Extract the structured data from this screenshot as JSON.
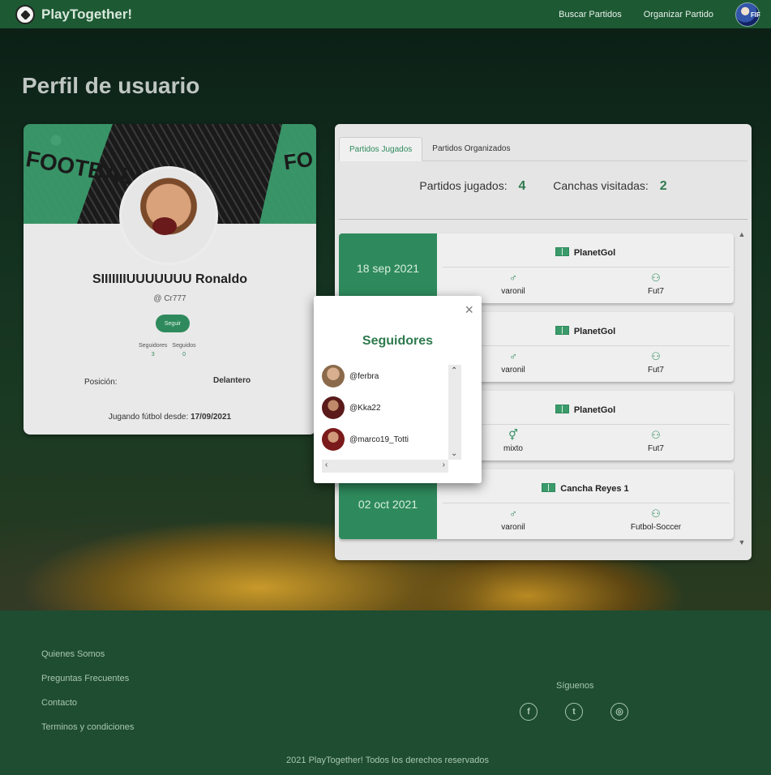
{
  "nav": {
    "brand": "PlayTogether!",
    "links": [
      "Buscar Partidos",
      "Organizar Partido"
    ],
    "avatar_badge": "FIF"
  },
  "page": {
    "title": "Perfil de usuario"
  },
  "profile": {
    "cover_word_left": "FOOTBALL",
    "cover_word_right": "FO",
    "name": "SIIIIIIIUUUUUUU Ronaldo",
    "username": "@ Cr777",
    "follow_button": "Seguir",
    "followers_label": "Seguidores",
    "followers_count": "3",
    "following_label": "Seguidos",
    "following_count": "0",
    "position_label": "Posición:",
    "position_value": "Delantero",
    "since_label": "Jugando fútbol desde:",
    "since_value": "17/09/2021"
  },
  "matches": {
    "tabs": [
      "Partidos Jugados",
      "Partidos Organizados"
    ],
    "played_label": "Partidos jugados:",
    "played_count": "4",
    "venues_label": "Canchas visitadas:",
    "venues_count": "2",
    "items": [
      {
        "date": "18 sep 2021",
        "venue": "PlanetGol",
        "gender": "varonil",
        "type": "Fut7"
      },
      {
        "date": "",
        "venue": "PlanetGol",
        "gender": "varonil",
        "type": "Fut7"
      },
      {
        "date": "",
        "venue": "PlanetGol",
        "gender": "mixto",
        "type": "Fut7"
      },
      {
        "date": "02 oct 2021",
        "venue": "Cancha Reyes 1",
        "gender": "varonil",
        "type": "Futbol-Soccer"
      }
    ]
  },
  "modal": {
    "title": "Seguidores",
    "close": "×",
    "followers": [
      {
        "handle": "@ferbra",
        "color": "#8a6a4a"
      },
      {
        "handle": "@Kka22",
        "color": "#5a1a1a"
      },
      {
        "handle": "@marco19_Totti",
        "color": "#7a1a1a"
      }
    ]
  },
  "footer": {
    "links": [
      "Quienes Somos",
      "Preguntas Frecuentes",
      "Contacto",
      "Terminos y condiciones"
    ],
    "follow_title": "Síguenos",
    "social": [
      "facebook-icon",
      "twitter-icon",
      "instagram-icon"
    ],
    "copyright": "2021 PlayTogether! Todos los derechos reservados"
  },
  "colors": {
    "brand_green": "#2e8a5c",
    "nav_green": "#1d5a34",
    "footer_green": "#1f4d31"
  }
}
